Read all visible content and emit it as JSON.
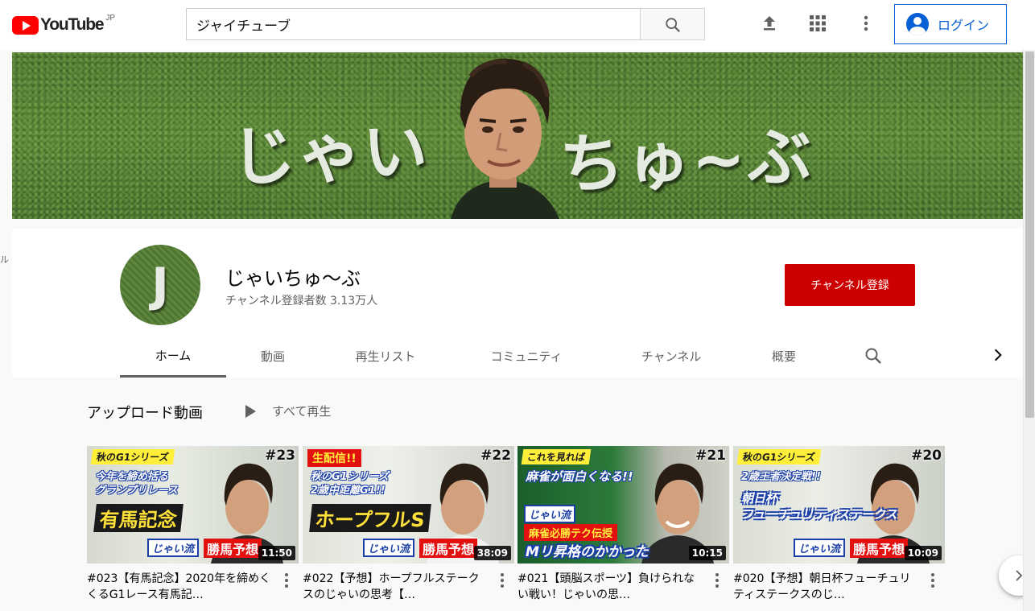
{
  "topbar": {
    "logo_text": "YouTube",
    "logo_region": "JP",
    "search_value": "ジャイチューブ",
    "login_label": "ログイン",
    "icons": [
      "search-icon",
      "upload-icon",
      "apps-icon",
      "more-vert-icon",
      "account-icon"
    ]
  },
  "banner": {
    "text_left": "じゃい",
    "text_right": "ちゅ~ぶ"
  },
  "channel": {
    "avatar_letter": "J",
    "name": "じゃいちゅ～ぶ",
    "subscribers": "チャンネル登録者数 3.13万人",
    "subscribe_label": "チャンネル登録",
    "subscribe_color": "#cc0000"
  },
  "tabs": [
    {
      "label": "ホーム",
      "active": true
    },
    {
      "label": "動画"
    },
    {
      "label": "再生リスト"
    },
    {
      "label": "コミュニティ"
    },
    {
      "label": "チャンネル"
    },
    {
      "label": "概要"
    }
  ],
  "section": {
    "title": "アップロード動画",
    "play_all": "すべて再生"
  },
  "videos": [
    {
      "series": "秋のG1シリーズ",
      "number": "#23",
      "sub": "今年を締め括る\nグランプリレース",
      "main": "有馬記念",
      "tag": "じゃい流",
      "tag2": "勝馬予想",
      "duration": "11:50",
      "title": "#023【有馬記念】2020年を締めくくるG1レース有馬記…"
    },
    {
      "series": "生配信!!",
      "number": "#22",
      "sub": "秋のG1シリーズ\n2歳中距離G1!!",
      "main": "ホープフルS",
      "tag": "じゃい流",
      "tag2": "勝馬予想",
      "duration": "38:09",
      "title": "#022【予想】ホープフルステークスのじゃいの思考【…"
    },
    {
      "series": "これを見れば",
      "number": "#21",
      "sub": "麻雀が面白くなる!!",
      "main": "麻雀必勝テク伝授",
      "tag": "じゃい流",
      "tag2": "Mリ昇格のかかった",
      "duration": "10:15",
      "title": "#021【頭脳スポーツ】負けられない戦い！じゃいの思…"
    },
    {
      "series": "秋のG1シリーズ",
      "number": "#20",
      "sub": "2歳王者決定戦!!",
      "main": "朝日杯\nフューチュリティステークス",
      "tag": "じゃい流",
      "tag2": "勝馬予想",
      "duration": "10:09",
      "title": "#020【予想】朝日杯フューチュリティステークスのじ…"
    }
  ],
  "left_stub": "ル"
}
